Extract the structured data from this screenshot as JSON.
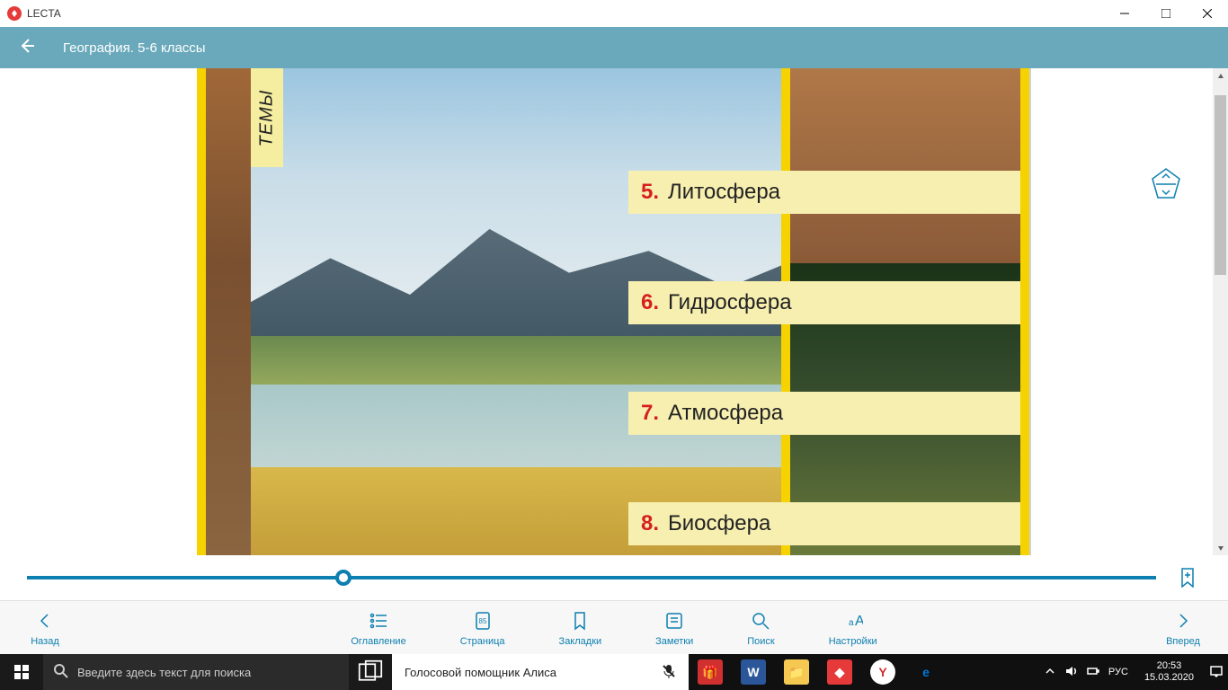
{
  "titlebar": {
    "appname": "LECTA"
  },
  "header": {
    "title": "География. 5-6 классы"
  },
  "page": {
    "tab_label": "ТЕМЫ",
    "topics": [
      {
        "num": "5.",
        "title": "Литосфера"
      },
      {
        "num": "6.",
        "title": "Гидросфера"
      },
      {
        "num": "7.",
        "title": "Атмосфера"
      },
      {
        "num": "8.",
        "title": "Биосфера"
      }
    ]
  },
  "toolbar": {
    "back": "Назад",
    "forward": "Вперед",
    "contents": "Оглавление",
    "page": "Страница",
    "page_num": "85",
    "bookmarks": "Закладки",
    "notes": "Заметки",
    "search": "Поиск",
    "settings": "Настройки"
  },
  "taskbar": {
    "search_placeholder": "Введите здесь текст для поиска",
    "alisa": "Голосовой помощник Алиса",
    "lang": "РУС",
    "time": "20:53",
    "date": "15.03.2020"
  }
}
